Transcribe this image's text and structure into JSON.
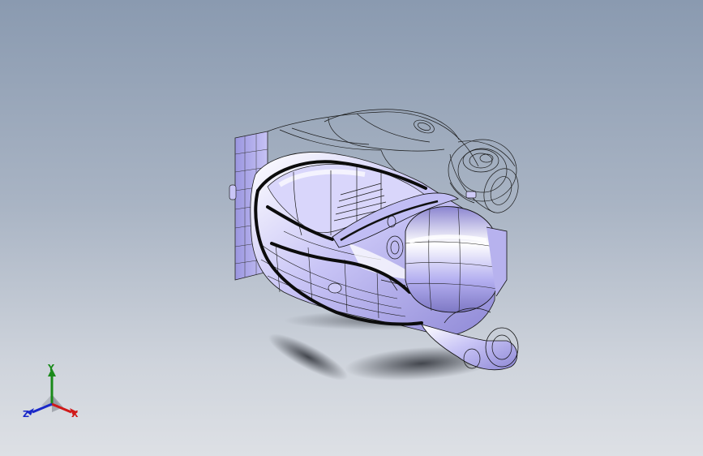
{
  "viewport": {
    "background_top": "#8a9ab0",
    "background_bottom": "#dde0e5"
  },
  "model": {
    "type": "3d-wireframe-shaded",
    "icon": "hovercraft-model-icon",
    "fill_color": "#b9b4f0",
    "edge_color": "#101010"
  },
  "triad": {
    "y_label": "Y",
    "x_label": "X",
    "z_label": "Z",
    "y_color": "#1a8a1a",
    "x_color": "#d01818",
    "z_color": "#1a28c8"
  }
}
